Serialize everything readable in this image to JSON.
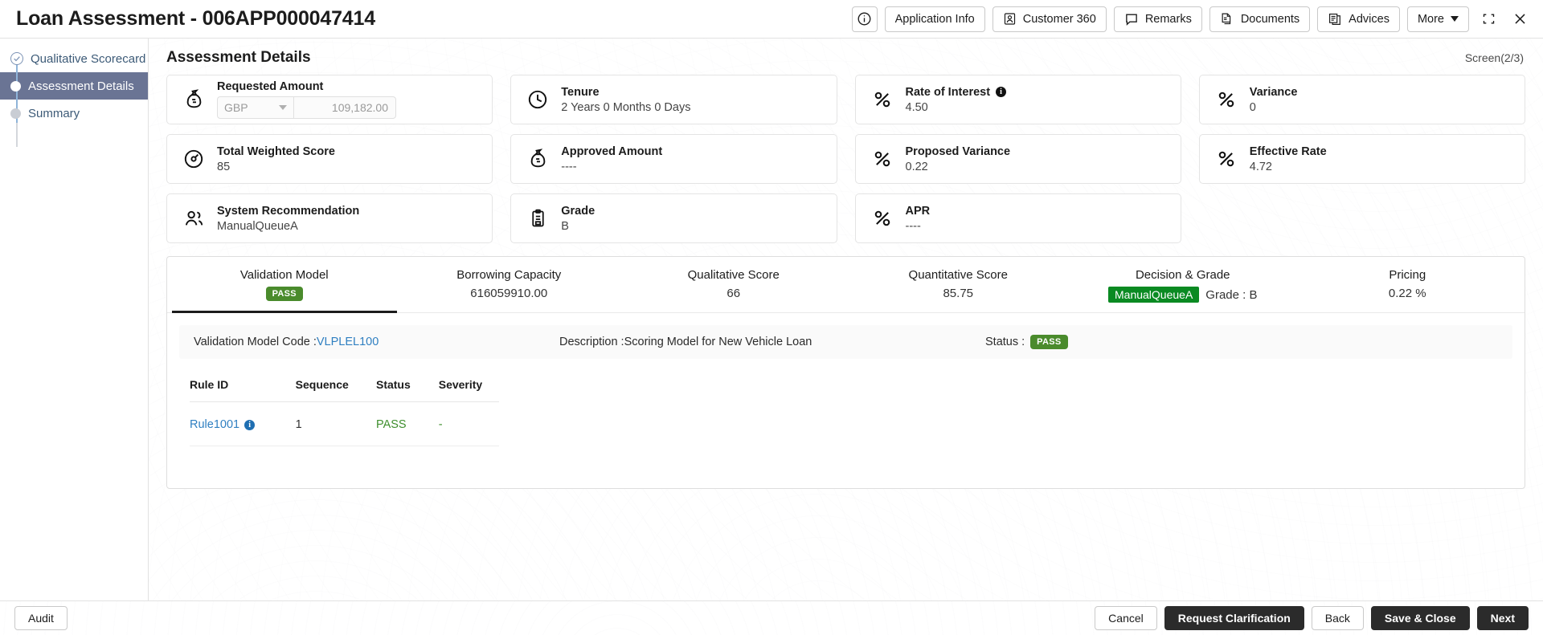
{
  "header": {
    "title": "Loan Assessment - 006APP000047414",
    "tools": [
      {
        "name": "info",
        "label": "",
        "icon": "info-circle-icon"
      },
      {
        "name": "application-info",
        "label": "Application Info",
        "icon": ""
      },
      {
        "name": "customer-360",
        "label": "Customer 360",
        "icon": "user-card-icon"
      },
      {
        "name": "remarks",
        "label": "Remarks",
        "icon": "comment-icon"
      },
      {
        "name": "documents",
        "label": "Documents",
        "icon": "document-icon"
      },
      {
        "name": "advices",
        "label": "Advices",
        "icon": "advice-icon"
      },
      {
        "name": "more",
        "label": "More",
        "icon": "chevron-down-icon"
      }
    ],
    "minimize_title": "Collapse",
    "close_title": "Close"
  },
  "sidebar": {
    "items": [
      {
        "label": "Qualitative Scorecard",
        "state": "completed"
      },
      {
        "label": "Assessment Details",
        "state": "active"
      },
      {
        "label": "Summary",
        "state": "pending"
      }
    ]
  },
  "page": {
    "title": "Assessment Details",
    "screen_count": "Screen(2/3)"
  },
  "cards": [
    {
      "name": "requested-amount",
      "label": "Requested Amount",
      "icon": "money-bag-icon",
      "type": "amount",
      "currency": "GBP",
      "amount": "109,182.00"
    },
    {
      "name": "tenure",
      "label": "Tenure",
      "icon": "clock-icon",
      "value": "2 Years 0 Months 0 Days"
    },
    {
      "name": "rate-of-interest",
      "label": "Rate of Interest",
      "icon": "percent-icon",
      "value": "4.50",
      "info": true
    },
    {
      "name": "variance",
      "label": "Variance",
      "icon": "percent-icon",
      "value": "0"
    },
    {
      "name": "total-weighted-score",
      "label": "Total Weighted Score",
      "icon": "gauge-icon",
      "value": "85"
    },
    {
      "name": "approved-amount",
      "label": "Approved Amount",
      "icon": "money-bag-icon",
      "value": "----"
    },
    {
      "name": "proposed-variance",
      "label": "Proposed Variance",
      "icon": "percent-icon",
      "value": "0.22"
    },
    {
      "name": "effective-rate",
      "label": "Effective Rate",
      "icon": "percent-icon",
      "value": "4.72"
    },
    {
      "name": "system-recommendation",
      "label": "System Recommendation",
      "icon": "users-icon",
      "value": "ManualQueueA"
    },
    {
      "name": "grade",
      "label": "Grade",
      "icon": "clipboard-icon",
      "value": "B"
    },
    {
      "name": "apr",
      "label": "APR",
      "icon": "percent-icon",
      "value": "----"
    }
  ],
  "tabs": [
    {
      "name": "validation-model",
      "label": "Validation Model",
      "value": "",
      "badge": "PASS",
      "active": true
    },
    {
      "name": "borrowing-capacity",
      "label": "Borrowing Capacity",
      "value": "616059910.00",
      "active": false
    },
    {
      "name": "qualitative-score",
      "label": "Qualitative Score",
      "value": "66",
      "active": false
    },
    {
      "name": "quantitative-score",
      "label": "Quantitative Score",
      "value": "85.75",
      "active": false
    },
    {
      "name": "decision-and-grade",
      "label": "Decision & Grade",
      "value": "Grade : B",
      "decision_badge": "ManualQueueA",
      "active": false
    },
    {
      "name": "pricing",
      "label": "Pricing",
      "value": "0.22 %",
      "active": false
    }
  ],
  "detail": {
    "code_label": "Validation Model Code :",
    "code_value": "VLPLEL100",
    "description_label": "Description :",
    "description_value": "Scoring Model for New Vehicle Loan",
    "status_label": "Status :",
    "status_value": "PASS"
  },
  "rules_table": {
    "columns": [
      "Rule ID",
      "Sequence",
      "Status",
      "Severity"
    ],
    "rows": [
      {
        "rule_id": "Rule1001",
        "sequence": "1",
        "status": "PASS",
        "severity": "-"
      }
    ]
  },
  "footer": {
    "audit_label": "Audit",
    "buttons": [
      {
        "name": "cancel",
        "label": "Cancel",
        "style": "light"
      },
      {
        "name": "request-clarification",
        "label": "Request Clarification",
        "style": "dark"
      },
      {
        "name": "back",
        "label": "Back",
        "style": "light"
      },
      {
        "name": "save-and-close",
        "label": "Save & Close",
        "style": "dark"
      },
      {
        "name": "next",
        "label": "Next",
        "style": "dark"
      }
    ]
  },
  "colors": {
    "pass_green": "#4a8b2c",
    "decision_green": "#0a8a22",
    "link_blue": "#2f7fc1",
    "active_step": "#6a7494",
    "dark_button": "#2b2b2b"
  }
}
